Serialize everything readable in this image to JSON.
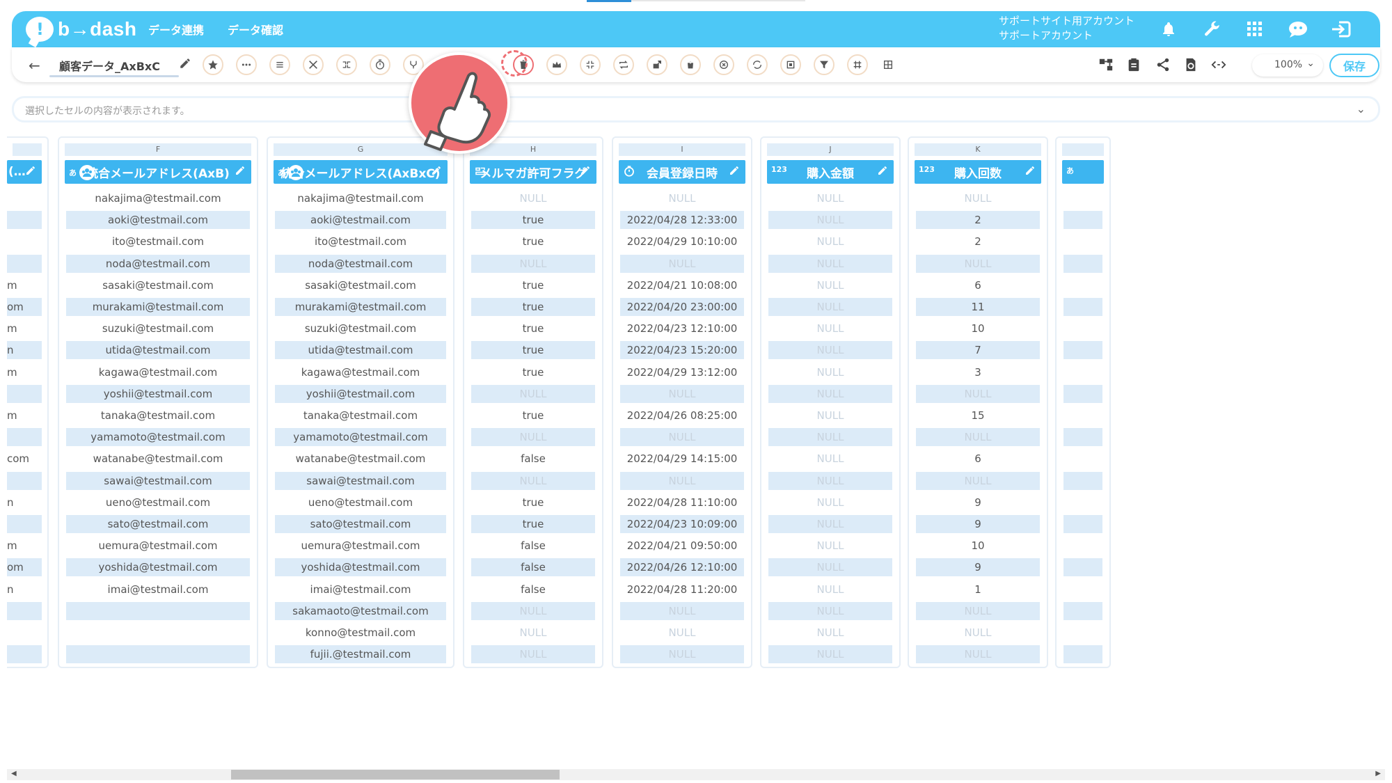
{
  "header": {
    "logo_mark": "!",
    "logo_text": "b→dash",
    "nav": [
      "データ連携",
      "データ確認"
    ],
    "account_line1": "サポートサイト用アカウント",
    "account_line2": "サポートアカウント",
    "brand_color": "#4dc8f6"
  },
  "toolbar": {
    "back": "←",
    "table_name": "顧客データ_AxBxC",
    "zoom": "100%",
    "save_label": "保存"
  },
  "cellinfo": {
    "placeholder": "選択したセルの内容が表示されます。"
  },
  "columns": [
    {
      "letter": "",
      "type_icon": "",
      "title": "(…",
      "cells": [
        "",
        "",
        "",
        "",
        "m",
        "om",
        "m",
        "n",
        "m",
        "",
        "m",
        "",
        "com",
        "",
        "n",
        "",
        "m",
        "om",
        "n",
        "",
        "",
        ""
      ],
      "alt_pattern": true
    },
    {
      "letter": "F",
      "type_icon": "あ",
      "title": "統合メールアドレス(AxB)",
      "cells": [
        "nakajima@testmail.com",
        "aoki@testmail.com",
        "ito@testmail.com",
        "noda@testmail.com",
        "sasaki@testmail.com",
        "murakami@testmail.com",
        "suzuki@testmail.com",
        "utida@testmail.com",
        "kagawa@testmail.com",
        "yoshii@testmail.com",
        "tanaka@testmail.com",
        "yamamoto@testmail.com",
        "watanabe@testmail.com",
        "sawai@testmail.com",
        "ueno@testmail.com",
        "sato@testmail.com",
        "uemura@testmail.com",
        "yoshida@testmail.com",
        "imai@testmail.com",
        "",
        "",
        ""
      ]
    },
    {
      "letter": "G",
      "type_icon": "あ",
      "title": "統合メールアドレス(AxBxC)",
      "cells": [
        "nakajima@testmail.com",
        "aoki@testmail.com",
        "ito@testmail.com",
        "noda@testmail.com",
        "sasaki@testmail.com",
        "murakami@testmail.com",
        "suzuki@testmail.com",
        "utida@testmail.com",
        "kagawa@testmail.com",
        "yoshii@testmail.com",
        "tanaka@testmail.com",
        "yamamoto@testmail.com",
        "watanabe@testmail.com",
        "sawai@testmail.com",
        "ueno@testmail.com",
        "sato@testmail.com",
        "uemura@testmail.com",
        "yoshida@testmail.com",
        "imai@testmail.com",
        "sakamaoto@testmail.com",
        "konno@testmail.com",
        "fujii.@testmail.com"
      ]
    },
    {
      "letter": "H",
      "type_icon": "",
      "title": "メルマガ許可フラグ",
      "cells": [
        "NULL",
        "true",
        "true",
        "NULL",
        "true",
        "true",
        "true",
        "true",
        "true",
        "NULL",
        "true",
        "NULL",
        "false",
        "NULL",
        "true",
        "true",
        "false",
        "false",
        "false",
        "NULL",
        "NULL",
        "NULL"
      ]
    },
    {
      "letter": "I",
      "type_icon": "",
      "title": "会員登録日時",
      "cells": [
        "NULL",
        "2022/04/28 12:33:00",
        "2022/04/29 10:10:00",
        "NULL",
        "2022/04/21 10:08:00",
        "2022/04/20 23:00:00",
        "2022/04/23 12:10:00",
        "2022/04/23 15:20:00",
        "2022/04/29 13:12:00",
        "NULL",
        "2022/04/26 08:25:00",
        "NULL",
        "2022/04/29 14:15:00",
        "NULL",
        "2022/04/28 11:10:00",
        "2022/04/23 10:09:00",
        "2022/04/21 09:50:00",
        "2022/04/26 12:10:00",
        "2022/04/28 11:20:00",
        "NULL",
        "NULL",
        "NULL"
      ]
    },
    {
      "letter": "J",
      "type_icon": "123",
      "title": "購入金額",
      "cells": [
        "NULL",
        "NULL",
        "NULL",
        "NULL",
        "NULL",
        "NULL",
        "NULL",
        "NULL",
        "NULL",
        "NULL",
        "NULL",
        "NULL",
        "NULL",
        "NULL",
        "NULL",
        "NULL",
        "NULL",
        "NULL",
        "NULL",
        "NULL",
        "NULL",
        "NULL"
      ]
    },
    {
      "letter": "K",
      "type_icon": "123",
      "title": "購入回数",
      "cells": [
        "NULL",
        "2",
        "2",
        "NULL",
        "6",
        "11",
        "10",
        "7",
        "3",
        "NULL",
        "15",
        "NULL",
        "6",
        "NULL",
        "9",
        "9",
        "10",
        "9",
        "1",
        "NULL",
        "NULL",
        "NULL"
      ]
    },
    {
      "letter": "",
      "type_icon": "あ",
      "title": "",
      "cells": [
        "",
        "",
        "",
        "",
        "",
        "",
        "",
        "",
        "",
        "",
        "",
        "",
        "",
        "",
        "",
        "",
        "",
        "",
        "",
        "",
        "",
        ""
      ]
    }
  ]
}
